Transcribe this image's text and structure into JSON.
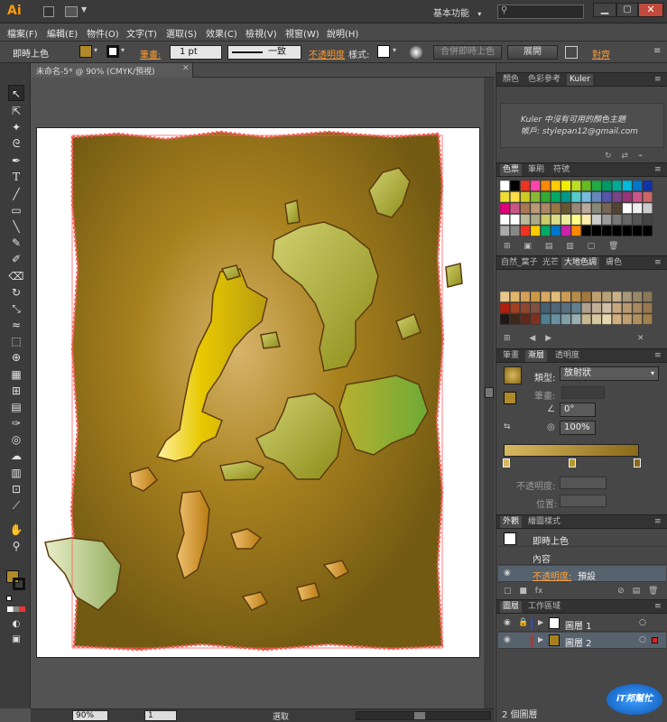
{
  "app": {
    "logo": "Ai",
    "workspace": "基本功能",
    "search_placeholder": ""
  },
  "menu": [
    "檔案(F)",
    "編輯(E)",
    "物件(O)",
    "文字(T)",
    "選取(S)",
    "效果(C)",
    "檢視(V)",
    "視窗(W)",
    "說明(H)"
  ],
  "control": {
    "selection": "即時上色",
    "stroke_label": "筆畫:",
    "stroke_value": "1 pt",
    "brush_value": "一致",
    "opacity_label": "不透明度",
    "style_label": "樣式:",
    "merge_btn": "合併即時上色",
    "expand_btn": "展開",
    "align_label": "對齊"
  },
  "document": {
    "tab_title": "未命名-5* @ 90% (CMYK/預視)"
  },
  "status": {
    "zoom": "90%",
    "page": "1",
    "tool": "選取"
  },
  "panels": {
    "color_tabs": [
      "顏色",
      "色彩參考",
      "Kuler"
    ],
    "kuler_msg1": "Kuler 中沒有可用的顏色主題",
    "kuler_msg2": "帳戶: stylepan12@gmail.com",
    "swatch_tabs": [
      "色票",
      "筆刷",
      "符號"
    ],
    "lib_tabs": [
      "自然_葉子",
      "光芒",
      "大地色調",
      "膚色"
    ],
    "gradient_tabs": [
      "筆畫",
      "漸層",
      "透明度"
    ],
    "gradient": {
      "type_label": "類型:",
      "type_value": "放射狀",
      "stroke_label": "筆畫:",
      "angle": "0°",
      "ratio": "100%",
      "opacity_label": "不透明度:",
      "location_label": "位置:"
    },
    "appearance_tabs": [
      "外觀",
      "繪圖樣式"
    ],
    "appearance": {
      "title": "即時上色",
      "content": "內容",
      "opacity_label": "不透明度:",
      "opacity_value": "預設"
    },
    "layer_tabs": [
      "圖層",
      "工作區域"
    ],
    "layers": [
      {
        "name": "圖層 1",
        "color": "#2a4dcc"
      },
      {
        "name": "圖層 2",
        "color": "#d22"
      }
    ],
    "layer_count": "2 個圖層"
  },
  "watermark": {
    "brand": "iT邦幫忙"
  },
  "colors": {
    "accent": "#ffa040",
    "paper": "#ffffff",
    "bg_gradient_center": "#d4b062",
    "bg_gradient_edge": "#7a5f16"
  }
}
